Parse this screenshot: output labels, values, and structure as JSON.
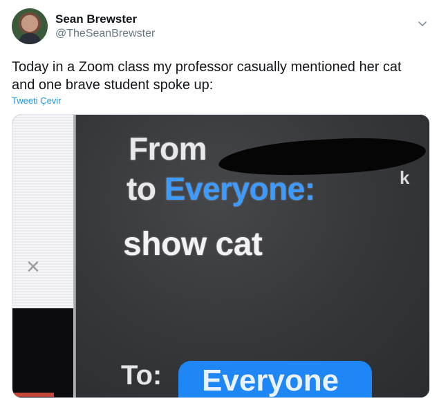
{
  "tweet": {
    "author_name": "Sean Brewster",
    "author_handle": "@TheSeanBrewster",
    "text_line1": "Today in a Zoom class my professor casually mentioned her cat",
    "text_line2": "and one brave student spoke up:",
    "translate_label": "Tweeti Çevir"
  },
  "media": {
    "chat_from": "From",
    "chat_to_prefix": "to",
    "chat_to_recipient": "Everyone:",
    "chat_message": "show cat",
    "redaction_tail": "k",
    "close_glyph": "×",
    "to_label": "To:",
    "to_pill_value": "Everyone"
  },
  "colors": {
    "link": "#1b95e0",
    "handle": "#657786",
    "zoom_blue": "#1f86f5"
  },
  "icons": [
    "avatar",
    "chevron-down-icon",
    "close-icon"
  ]
}
